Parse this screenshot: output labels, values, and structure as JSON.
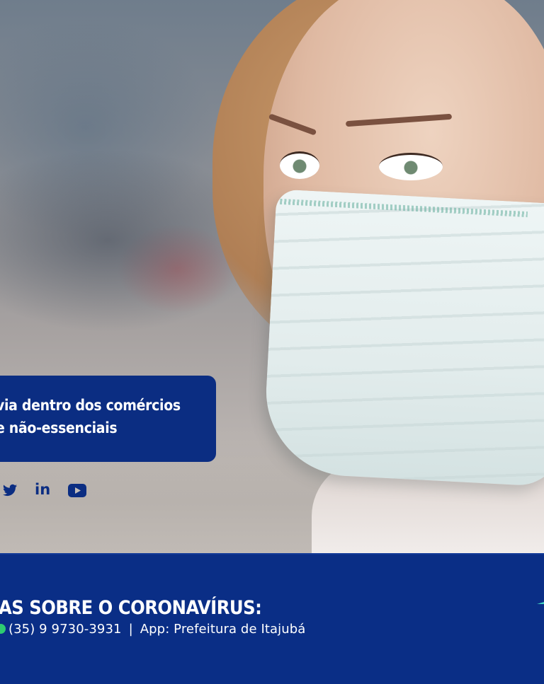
{
  "banner": {
    "line1": "via dentro dos comércios",
    "line2": "e não-essenciais"
  },
  "social": {
    "icons": [
      "twitter-icon",
      "linkedin-icon",
      "youtube-icon"
    ],
    "linkedin_text": "in"
  },
  "footer": {
    "headline": "AS SOBRE O CORONAVÍRUS:",
    "phone": "(35) 9 9730-3931",
    "separator": "|",
    "app_text": "App: Prefeitura de Itajubá"
  },
  "colors": {
    "navy": "#0b2d82",
    "whatsapp_green": "#2ecc71",
    "text": "#ffffff"
  }
}
